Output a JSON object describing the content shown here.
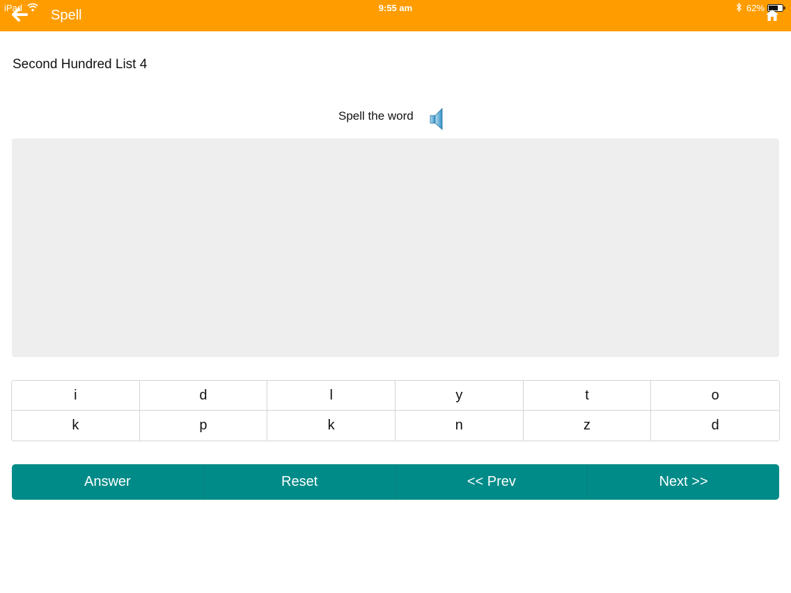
{
  "status_bar": {
    "carrier": "iPad",
    "time": "9:55 am",
    "battery": "62%"
  },
  "nav": {
    "title": "Spell",
    "back_icon": "back-arrow-icon",
    "home_icon": "home-icon"
  },
  "list_title": "Second Hundred List 4",
  "prompt": {
    "text": "Spell the word",
    "icon": "speaker-icon"
  },
  "answer_area": {
    "value": ""
  },
  "letters": [
    "i",
    "d",
    "l",
    "y",
    "t",
    "o",
    "k",
    "p",
    "k",
    "n",
    "z",
    "d"
  ],
  "actions": {
    "answer": "Answer",
    "reset": "Reset",
    "prev": "<< Prev",
    "next": "Next >>"
  },
  "colors": {
    "topbar": "#ff9d00",
    "action_bar": "#008b88",
    "answer_area": "#efeeef"
  }
}
